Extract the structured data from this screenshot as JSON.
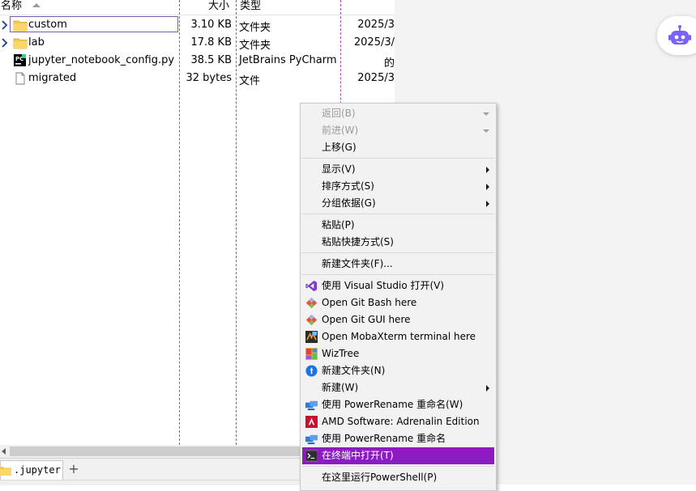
{
  "explorer": {
    "columns": {
      "name": "名称",
      "size": "大小",
      "type": "类型"
    },
    "files": [
      {
        "name": "custom",
        "size": "3.10 KB",
        "type": "文件夹",
        "date": "2025/3",
        "icon": "folder-icon"
      },
      {
        "name": "lab",
        "size": "17.8 KB",
        "type": "文件夹",
        "date": "2025/3/",
        "icon": "folder-icon"
      },
      {
        "name": "jupyter_notebook_config.py",
        "size": "38.5 KB",
        "type": "JetBrains PyCharm",
        "date": "的",
        "icon": "pycharm-file-icon"
      },
      {
        "name": "migrated",
        "size": "32 bytes",
        "type": "文件",
        "date": "2025/3",
        "icon": "file-icon"
      }
    ],
    "tab": {
      "label": ".jupyter",
      "add": "+"
    }
  },
  "context_menu": {
    "items": [
      {
        "label": "返回(B)",
        "disabled": true
      },
      {
        "label": "前进(W)",
        "disabled": true
      },
      {
        "label": "上移(G)"
      },
      {
        "label": "显示(V)"
      },
      {
        "label": "排序方式(S)"
      },
      {
        "label": "分组依据(G)"
      },
      {
        "label": "粘贴(P)"
      },
      {
        "label": "粘贴快捷方式(S)"
      },
      {
        "label": "新建文件夹(F)..."
      },
      {
        "label": "使用 Visual Studio 打开(V)",
        "icon": "visual-studio-icon"
      },
      {
        "label": "Open Git Bash here",
        "icon": "git-icon"
      },
      {
        "label": "Open Git GUI here",
        "icon": "git-icon"
      },
      {
        "label": "Open MobaXterm terminal here",
        "icon": "mobaxterm-icon"
      },
      {
        "label": "WizTree",
        "icon": "wiztree-icon"
      },
      {
        "label": "新建文件夹(N)",
        "icon": "new-folder-blue-icon"
      },
      {
        "label": "新建(W)"
      },
      {
        "label": "使用 PowerRename 重命名(W)",
        "icon": "powerrename-icon"
      },
      {
        "label": "AMD Software: Adrenalin Edition",
        "icon": "amd-icon"
      },
      {
        "label": "使用 PowerRename 重命名",
        "icon": "powerrename-icon"
      },
      {
        "label": "在终端中打开(T)",
        "icon": "terminal-icon",
        "highlighted": true
      },
      {
        "label": "在这里运行PowerShell(P)"
      }
    ]
  },
  "colors": {
    "highlight": "#8d1bc2",
    "folder": "#f7c948",
    "divider": "#a64ca6",
    "bot": "#7b61ff"
  }
}
